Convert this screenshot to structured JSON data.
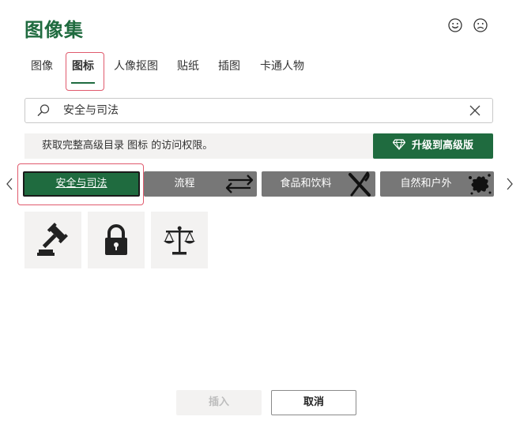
{
  "dialog": {
    "title": "图像集"
  },
  "tabs": [
    {
      "label": "图像",
      "active": false
    },
    {
      "label": "图标",
      "active": true
    },
    {
      "label": "人像抠图",
      "active": false
    },
    {
      "label": "贴纸",
      "active": false
    },
    {
      "label": "插图",
      "active": false
    },
    {
      "label": "卡通人物",
      "active": false
    }
  ],
  "search": {
    "value": "安全与司法",
    "icon": "search-icon",
    "clear_icon": "close-icon"
  },
  "banner": {
    "message": "获取完整高级目录 图标 的访问权限。",
    "upgrade_label": "升级到高级版",
    "upgrade_icon": "diamond-icon"
  },
  "categories": [
    {
      "label": "安全与司法",
      "active": true,
      "icon": null
    },
    {
      "label": "流程",
      "active": false,
      "icon": "swap-arrows-icon"
    },
    {
      "label": "食品和饮料",
      "active": false,
      "icon": "fork-knife-icon"
    },
    {
      "label": "自然和户外",
      "active": false,
      "icon": "paint-splat-icon"
    }
  ],
  "results": [
    {
      "name": "gavel-icon"
    },
    {
      "name": "padlock-icon"
    },
    {
      "name": "scales-of-justice-icon"
    }
  ],
  "footer": {
    "insert_label": "插入",
    "insert_enabled": false,
    "cancel_label": "取消"
  },
  "colors": {
    "accent": "#1f6b3f",
    "category_bg": "#777777",
    "highlight": "#e05a6d",
    "tile_bg": "#f3f2f1"
  }
}
